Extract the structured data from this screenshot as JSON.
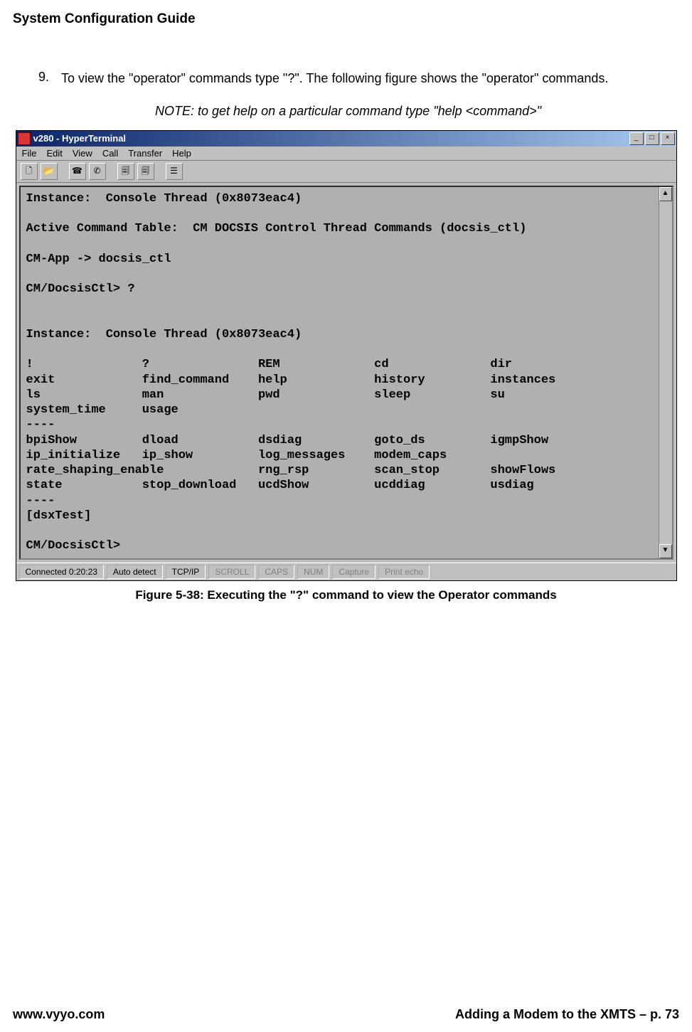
{
  "doc": {
    "title": "System Configuration Guide",
    "step_number": "9.",
    "step_text": "To view the \"operator\" commands type \"?\".  The following figure shows the \"operator\" commands.",
    "note": "NOTE: to get help on a particular command type \"help <command>\"",
    "figure_caption": "Figure 5-38:  Executing the \"?\" command to view the Operator commands",
    "footer_left": "www.vyyo.com",
    "footer_right": "Adding a Modem to the XMTS – p. 73"
  },
  "window": {
    "title": "v280 - HyperTerminal",
    "menu": [
      "File",
      "Edit",
      "View",
      "Call",
      "Transfer",
      "Help"
    ],
    "status": {
      "connected": "Connected 0:20:23",
      "detect": "Auto detect",
      "proto": "TCP/IP",
      "indicators": [
        "SCROLL",
        "CAPS",
        "NUM",
        "Capture",
        "Print echo"
      ]
    }
  },
  "terminal": {
    "lines": [
      "Instance:  Console Thread (0x8073eac4)",
      "",
      "Active Command Table:  CM DOCSIS Control Thread Commands (docsis_ctl)",
      "",
      "CM-App -> docsis_ctl",
      "",
      "CM/DocsisCtl> ?",
      "",
      "",
      "Instance:  Console Thread (0x8073eac4)",
      "",
      "!               ?               REM             cd              dir",
      "exit            find_command    help            history         instances",
      "ls              man             pwd             sleep           su",
      "system_time     usage",
      "----",
      "bpiShow         dload           dsdiag          goto_ds         igmpShow",
      "ip_initialize   ip_show         log_messages    modem_caps",
      "rate_shaping_enable             rng_rsp         scan_stop       showFlows",
      "state           stop_download   ucdShow         ucddiag         usdiag",
      "----",
      "[dsxTest]",
      "",
      "CM/DocsisCtl>"
    ]
  }
}
